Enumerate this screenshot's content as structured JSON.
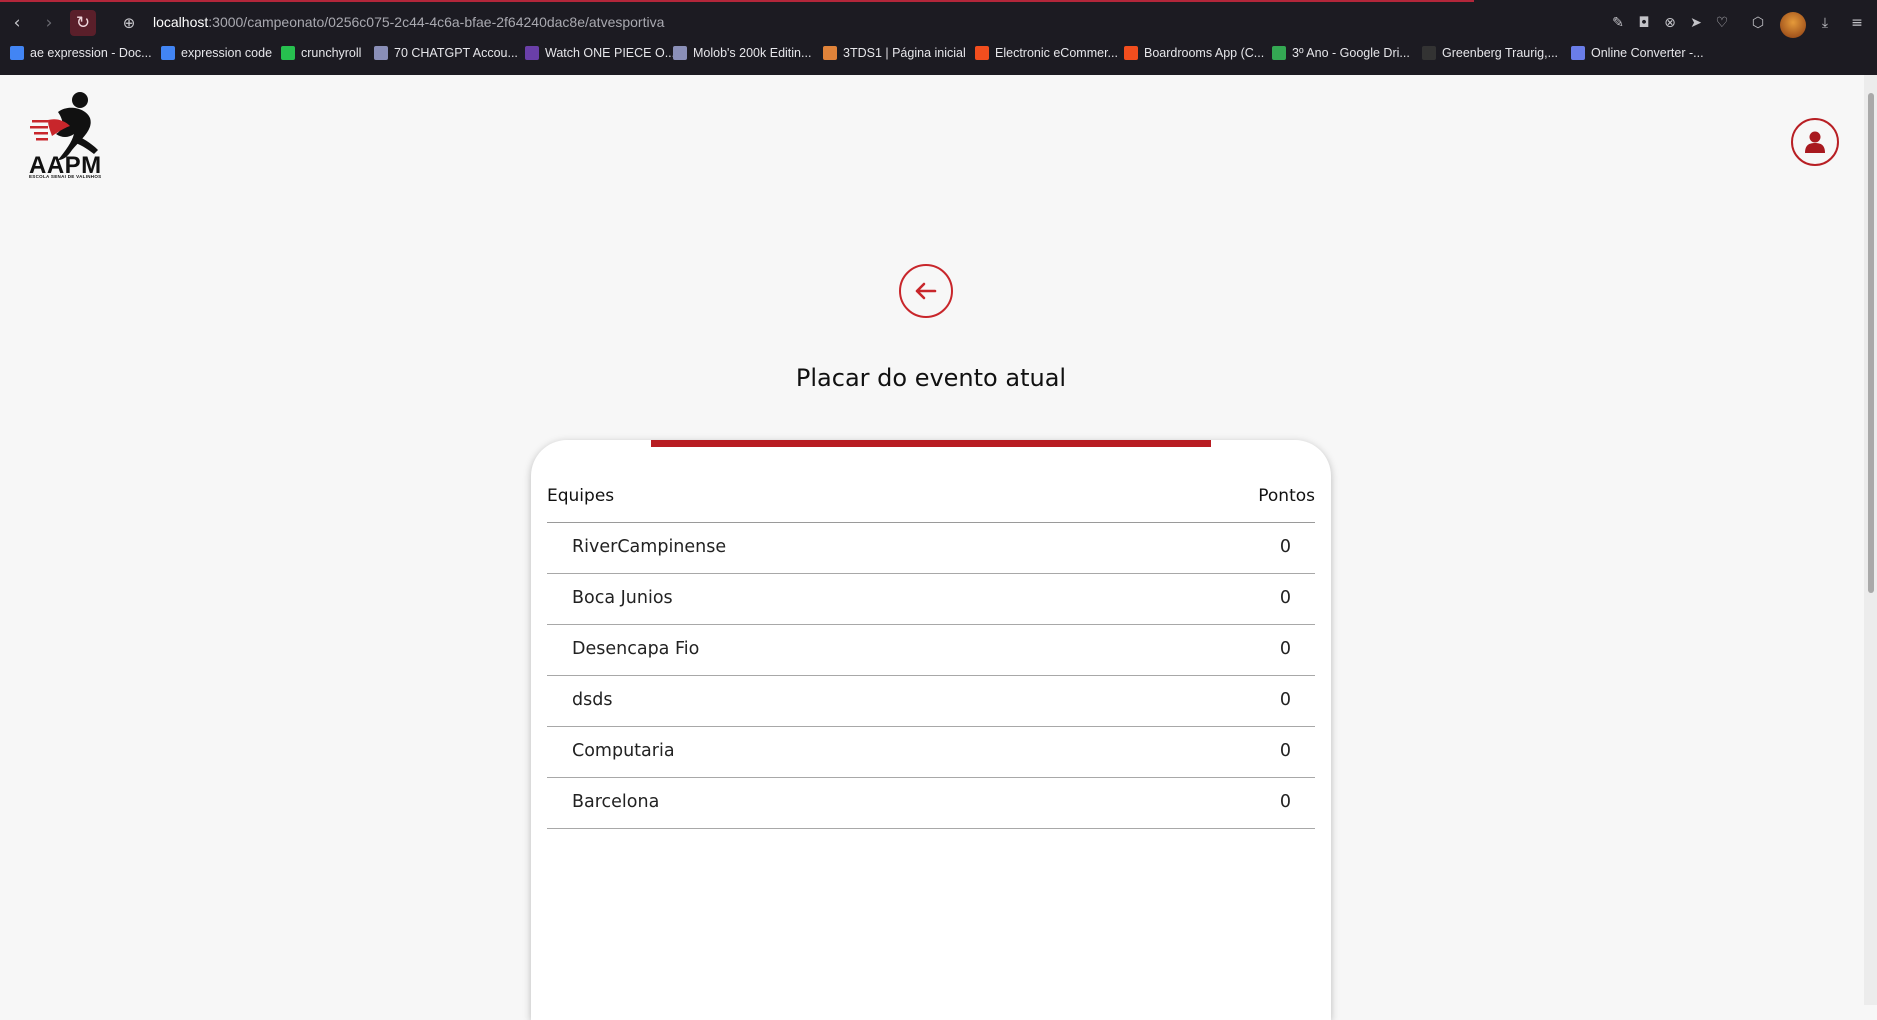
{
  "browser": {
    "url_host": "localhost",
    "url_path": ":3000/campeonato/0256c075-2c44-4c6a-bfae-2f64240dac8e/atvesportiva",
    "bookmarks": [
      {
        "label": "ae expression - Doc...",
        "color": "#4285f4"
      },
      {
        "label": "expression code",
        "color": "#4285f4"
      },
      {
        "label": "crunchyroll",
        "color": "#27c04f"
      },
      {
        "label": "70 CHATGPT Accou...",
        "color": "#8a8fb8"
      },
      {
        "label": "Watch ONE PIECE O...",
        "color": "#6a3fa8"
      },
      {
        "label": "Molob's 200k Editin...",
        "color": "#8a8fb8"
      },
      {
        "label": "3TDS1 | Página inicial",
        "color": "#e0833a"
      },
      {
        "label": "Electronic eCommer...",
        "color": "#f24e1e"
      },
      {
        "label": "Boardrooms App (C...",
        "color": "#f24e1e"
      },
      {
        "label": "3º Ano - Google Dri...",
        "color": "#34a853"
      },
      {
        "label": "Greenberg Traurig,...",
        "color": "#333333"
      },
      {
        "label": "Online Converter -...",
        "color": "#6a7de8"
      }
    ]
  },
  "brand": {
    "logo_text": "AAPM",
    "logo_subtext": "ESCOLA SENAI DE VALINHOS",
    "accent": "#b81d22"
  },
  "page": {
    "title": "Placar do evento atual",
    "back_icon": "arrow-left-icon",
    "user_icon": "user-icon"
  },
  "table": {
    "headers": {
      "team": "Equipes",
      "points": "Pontos"
    },
    "rows": [
      {
        "team": "RiverCampinense",
        "points": "0"
      },
      {
        "team": "Boca Junios",
        "points": "0"
      },
      {
        "team": "Desencapa Fio",
        "points": "0"
      },
      {
        "team": "dsds",
        "points": "0"
      },
      {
        "team": "Computaria",
        "points": "0"
      },
      {
        "team": "Barcelona",
        "points": "0"
      }
    ]
  }
}
